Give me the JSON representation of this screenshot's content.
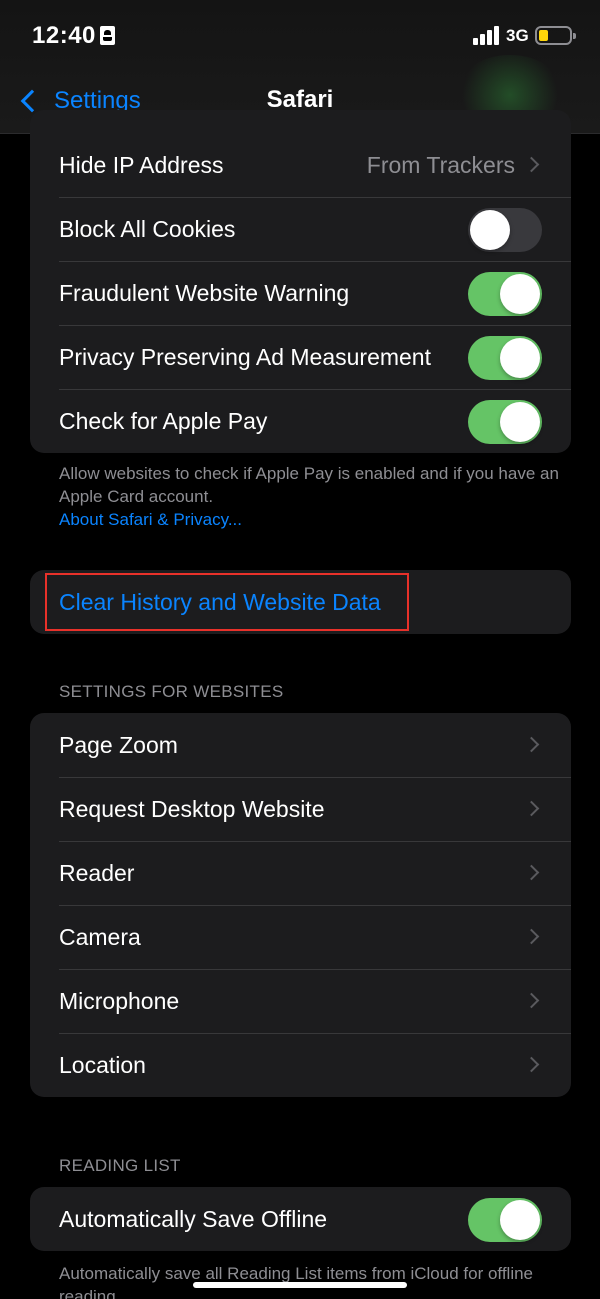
{
  "status": {
    "time": "12:40",
    "network": "3G",
    "battery_fraction": 0.3,
    "battery_color": "#ffd60a",
    "icons": [
      "contact-card-icon",
      "cellular-signal-icon",
      "battery-icon"
    ]
  },
  "nav": {
    "back_label": "Settings",
    "title": "Safari"
  },
  "privacy_group": {
    "items": [
      {
        "label": "Hide IP Address",
        "value": "From Trackers"
      },
      {
        "label": "Block All Cookies",
        "on": false
      },
      {
        "label": "Fraudulent Website Warning",
        "on": true
      },
      {
        "label": "Privacy Preserving Ad Measurement",
        "on": true
      },
      {
        "label": "Check for Apple Pay",
        "on": true
      }
    ],
    "footer": "Allow websites to check if Apple Pay is enabled and if you have an Apple Card account.",
    "footer_link": "About Safari & Privacy..."
  },
  "clear_data": {
    "label": "Clear History and Website Data"
  },
  "websites": {
    "header": "SETTINGS FOR WEBSITES",
    "items": [
      "Page Zoom",
      "Request Desktop Website",
      "Reader",
      "Camera",
      "Microphone",
      "Location"
    ]
  },
  "reading_list": {
    "header": "READING LIST",
    "item_label": "Automatically Save Offline",
    "item_on": true,
    "footer": "Automatically save all Reading List items from iCloud for offline reading."
  },
  "colors": {
    "accent": "#0a84ff",
    "toggle_on": "#65c466",
    "highlight": "#e8312a"
  }
}
